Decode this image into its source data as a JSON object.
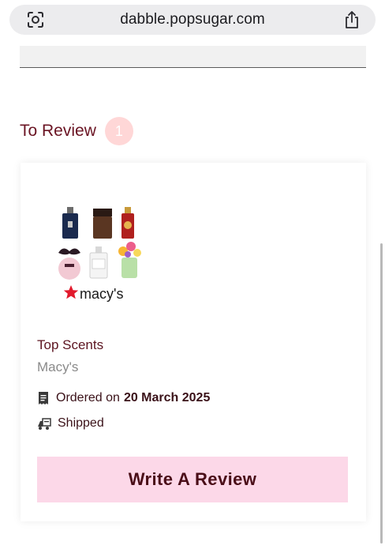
{
  "browser": {
    "url": "dabble.popsugar.com"
  },
  "section": {
    "title": "To Review",
    "count": "1"
  },
  "card": {
    "product_name": "Top Scents",
    "brand": "Macy's",
    "image_brand_text": "macy's",
    "order_label": "Ordered on",
    "order_date": "20 March 2025",
    "status": "Shipped",
    "button_label": "Write A Review"
  },
  "colors": {
    "heading": "#6a1423",
    "badge": "#ffd7d7",
    "button_bg": "#fcd8e8",
    "button_text": "#4a0e18",
    "macys_red": "#e21a2c"
  }
}
